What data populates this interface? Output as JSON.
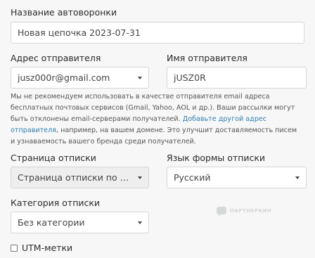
{
  "funnel_name": {
    "label": "Название автоворонки",
    "value": "Новая цепочка 2023-07-31"
  },
  "sender_address": {
    "label": "Адрес отправителя",
    "value": "jusz000r@gmail.com"
  },
  "sender_name": {
    "label": "Имя отправителя",
    "value": "jUSZ0R"
  },
  "note": {
    "text_before": "Мы не рекомендуем использовать в качестве отправителя email адреса бесплатных почтовых сервисов (Gmail, Yahoo, AOL и др.). Ваши рассылки могут быть отклонены email-серверами получателей. ",
    "link": "Добавьте другой адрес отправителя",
    "text_after": ", например, на вашем домене. Это улучшит доставляемость писем и узнаваемость вашего бренда среди получателей."
  },
  "unsubscribe_page": {
    "label": "Страница отписки",
    "value": "Страница отписки по умолч..."
  },
  "unsubscribe_language": {
    "label": "Язык формы отписки",
    "value": "Русский"
  },
  "unsubscribe_category": {
    "label": "Категория отписки",
    "value": "Без категории"
  },
  "utm": {
    "label": "UTM-метки",
    "checked": false
  },
  "watermark": {
    "text": "ПАРТНЕРКИН",
    "icon": "chat-bubble-logo"
  }
}
